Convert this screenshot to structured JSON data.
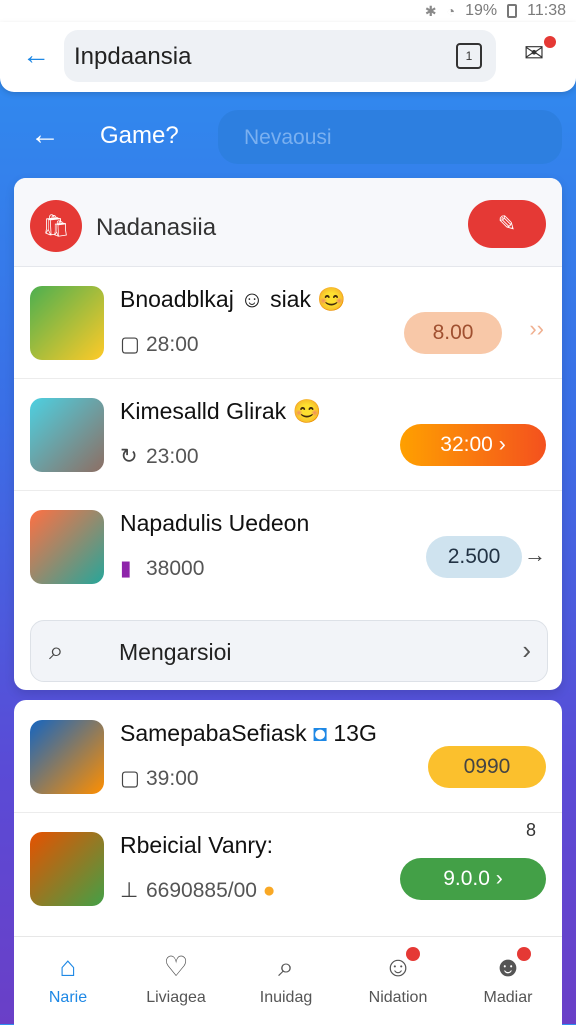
{
  "status": {
    "battery": "19%",
    "time": "11:38"
  },
  "topbar": {
    "search_text": "Inpdaansia"
  },
  "header2": {
    "title": "Game?",
    "search_placeholder": "Nevaousi"
  },
  "store": {
    "title": "Nadanasiia"
  },
  "apps": [
    {
      "name": "Bnoadblkaj ☺ siak 😊",
      "meta": "28:00",
      "price": "8.00"
    },
    {
      "name": "Kimesalld Glirak 😊",
      "meta": "23:00",
      "price": "32:00"
    },
    {
      "name": "Napadulis Uedeon",
      "meta": "38000",
      "price": "2.500"
    }
  ],
  "search_row": {
    "text": "Mengarsioi"
  },
  "apps2": [
    {
      "name": "SamepabaSefiask",
      "extra": "13G",
      "meta": "39:00",
      "price": "0990"
    },
    {
      "name": "Rbeicial Vanry:",
      "extra": "8",
      "meta": "6690885/00",
      "price": "9.0.0"
    }
  ],
  "nav": [
    {
      "label": "Narie",
      "icon": "home-icon"
    },
    {
      "label": "Liviagea",
      "icon": "heart-icon"
    },
    {
      "label": "Inuidag",
      "icon": "search-icon"
    },
    {
      "label": "Nidation",
      "icon": "user-icon"
    },
    {
      "label": "Madiar",
      "icon": "profile-icon"
    }
  ],
  "colors": {
    "primary": "#1e88e5",
    "accent_red": "#e53935",
    "orange": "#f57c00",
    "yellow": "#fbc02d",
    "green": "#43a047"
  }
}
